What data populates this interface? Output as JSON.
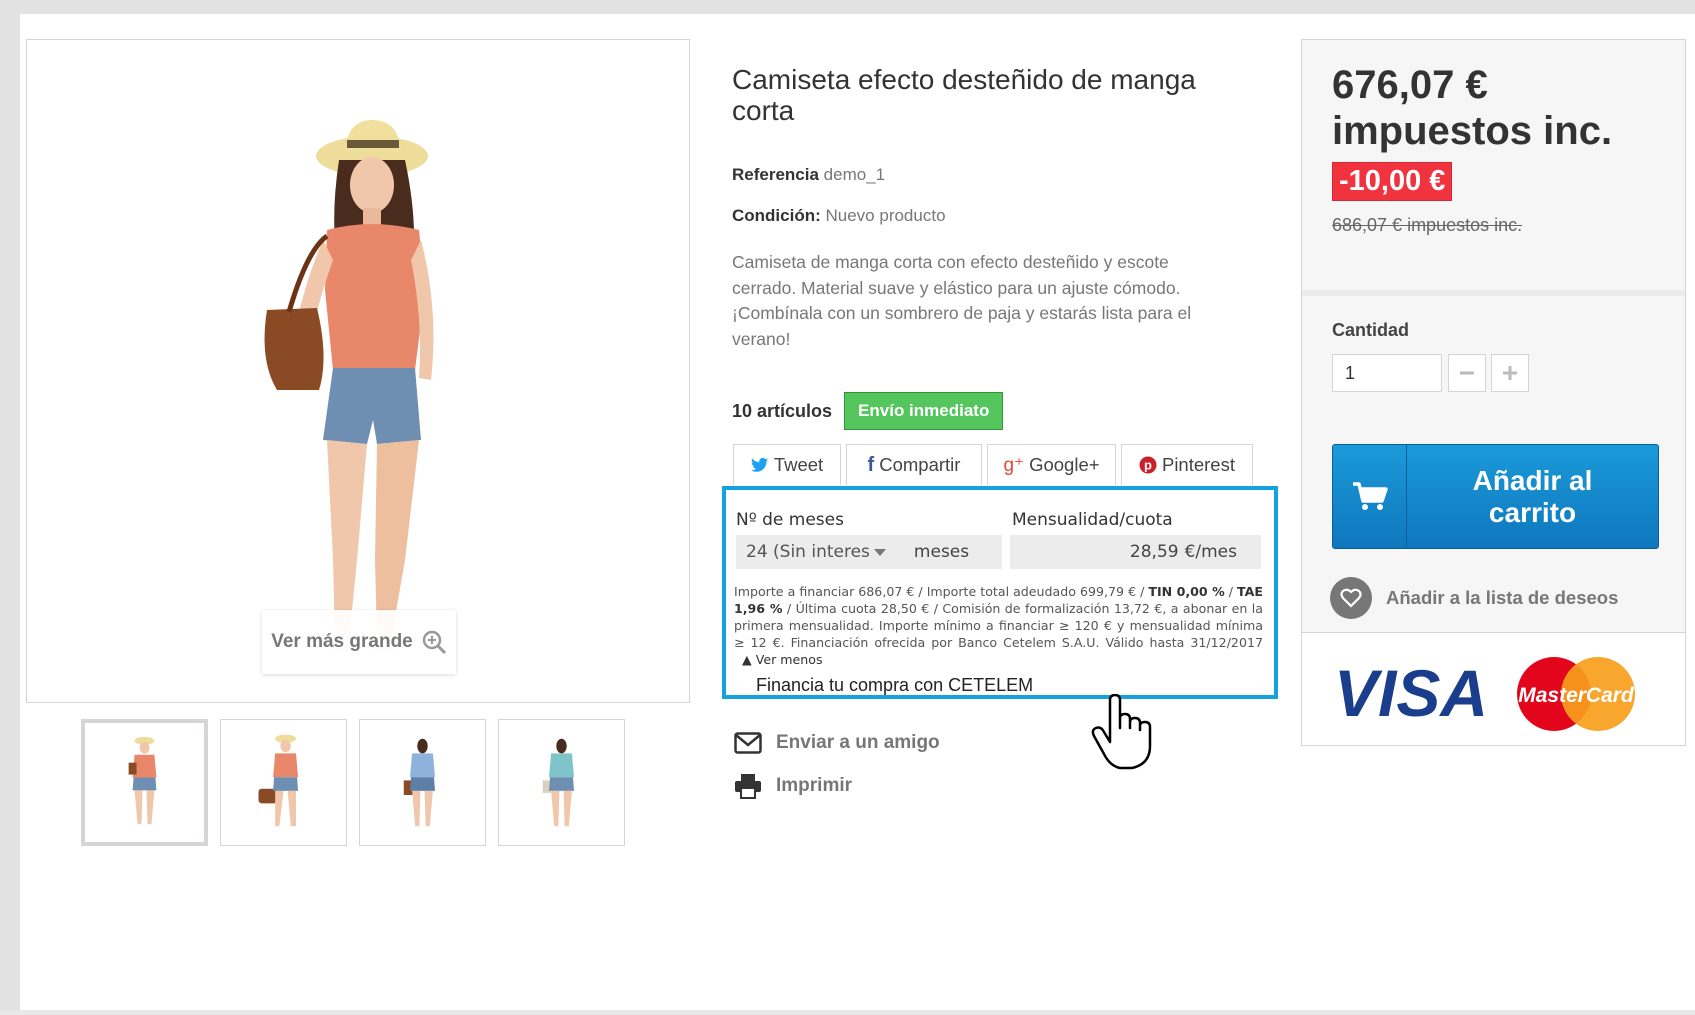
{
  "product": {
    "title": "Camiseta efecto desteñido de manga corta",
    "reference_label": "Referencia",
    "reference_value": "demo_1",
    "condition_label": "Condición:",
    "condition_value": "Nuevo producto",
    "description": "Camiseta de manga corta con efecto desteñido y escote cerrado. Material suave y elástico para un ajuste cómodo. ¡Combínala con un sombrero de paja y estarás lista para el verano!",
    "stock_text": "10 artículos",
    "stock_badge": "Envío inmediato"
  },
  "gallery": {
    "zoom_label": "Ver más grande",
    "thumbnails": [
      {
        "shirt_color": "#e9876a"
      },
      {
        "shirt_color": "#e9876a"
      },
      {
        "shirt_color": "#8db3dc"
      },
      {
        "shirt_color": "#7fc4c8"
      }
    ]
  },
  "share": {
    "tweet": "Tweet",
    "facebook": "Compartir",
    "google": "Google+",
    "pinterest": "Pinterest"
  },
  "financing": {
    "months_label": "Nº de meses",
    "quota_label": "Mensualidad/cuota",
    "months_selected": "24 (Sin interes",
    "months_unit": "meses",
    "quota_value": "28,59",
    "quota_unit": "€/mes",
    "legal_1": "Importe a financiar 686,07 € / Importe total adeudado 699,79 € / ",
    "legal_tin": "TIN 0,00 %",
    "legal_2": " / ",
    "legal_tae": "TAE 1,96 %",
    "legal_3": "  / Última cuota 28,50 € / Comisión de formalización 13,72 €, a abonar en la primera mensualidad. Importe mínimo a financiar ≥ 120 € y mensualidad mínima ≥ 12 €. Financiación ofrecida por Banco Cetelem S.A.U. Válido hasta 31/12/2017",
    "show_less": "Ver menos",
    "footer": "Financia tu compra con CETELEM"
  },
  "actions": {
    "send_friend": "Enviar a un amigo",
    "print": "Imprimir"
  },
  "buy": {
    "price_line1": "676,07 €",
    "price_line2": "impuestos inc.",
    "discount": "-10,00 €",
    "old_price": "686,07 € impuestos inc.",
    "quantity_label": "Cantidad",
    "quantity_value": "1",
    "cart_label": "Añadir al carrito",
    "wishlist_label": "Añadir a la lista de deseos",
    "card_brands": [
      "VISA",
      "MasterCard"
    ]
  },
  "colors": {
    "accent_blue": "#13a1e1",
    "cart_blue": "#1083c8",
    "stock_green": "#55c65e",
    "discount_red": "#f13340"
  }
}
